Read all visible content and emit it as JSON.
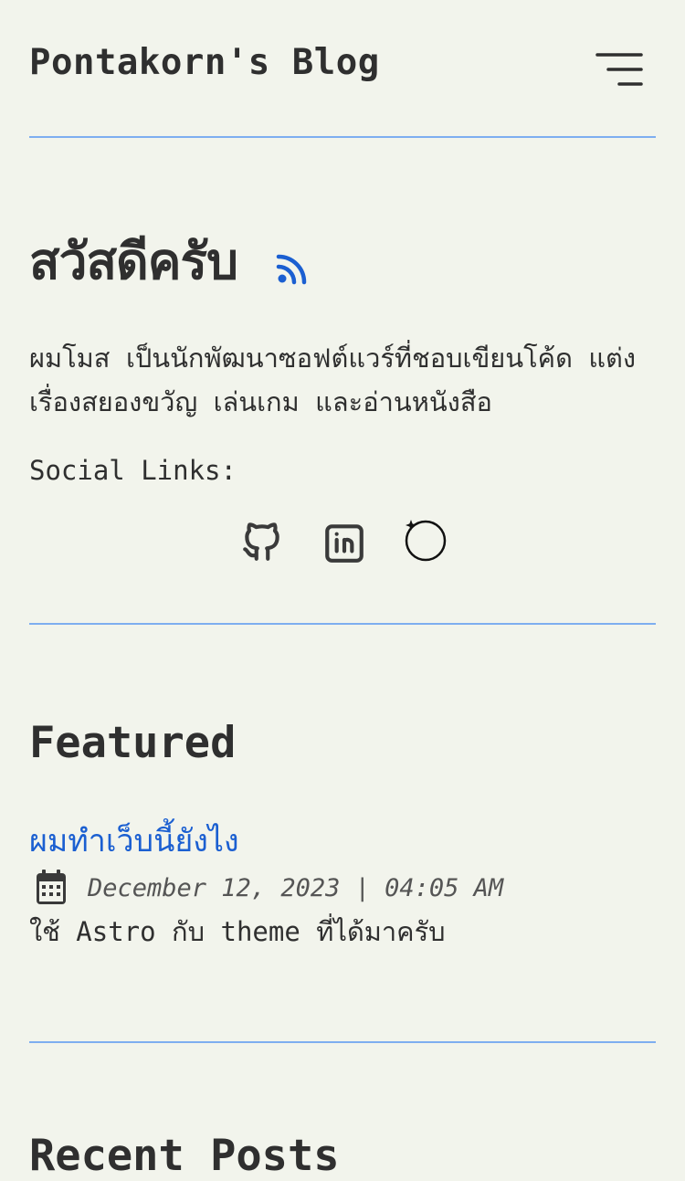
{
  "header": {
    "site_title": "Pontakorn's Blog",
    "menu_icon": "hamburger-menu-icon"
  },
  "hero": {
    "title": "สวัสดีครับ",
    "rss_icon": "rss-icon",
    "description": "ผมโมส เป็นนักพัฒนาซอฟต์แวร์ที่ชอบเขียนโค้ด แต่งเรื่องสยองขวัญ เล่นเกม และอ่านหนังสือ",
    "social_label": "Social Links:",
    "social_icons": [
      "github-icon",
      "linkedin-icon",
      "orbit-icon"
    ]
  },
  "featured": {
    "heading": "Featured",
    "posts": [
      {
        "title": "ผมทำเว็บนี้ยังไง",
        "date": "December 12, 2023 | 04:05 AM",
        "description": "ใช้ Astro กับ theme ที่ได้มาครับ"
      }
    ]
  },
  "recent": {
    "heading": "Recent Posts"
  },
  "colors": {
    "background": "#f2f4ec",
    "text": "#2f2f2f",
    "accent": "#1b5fd1",
    "divider": "#7eaef0"
  }
}
